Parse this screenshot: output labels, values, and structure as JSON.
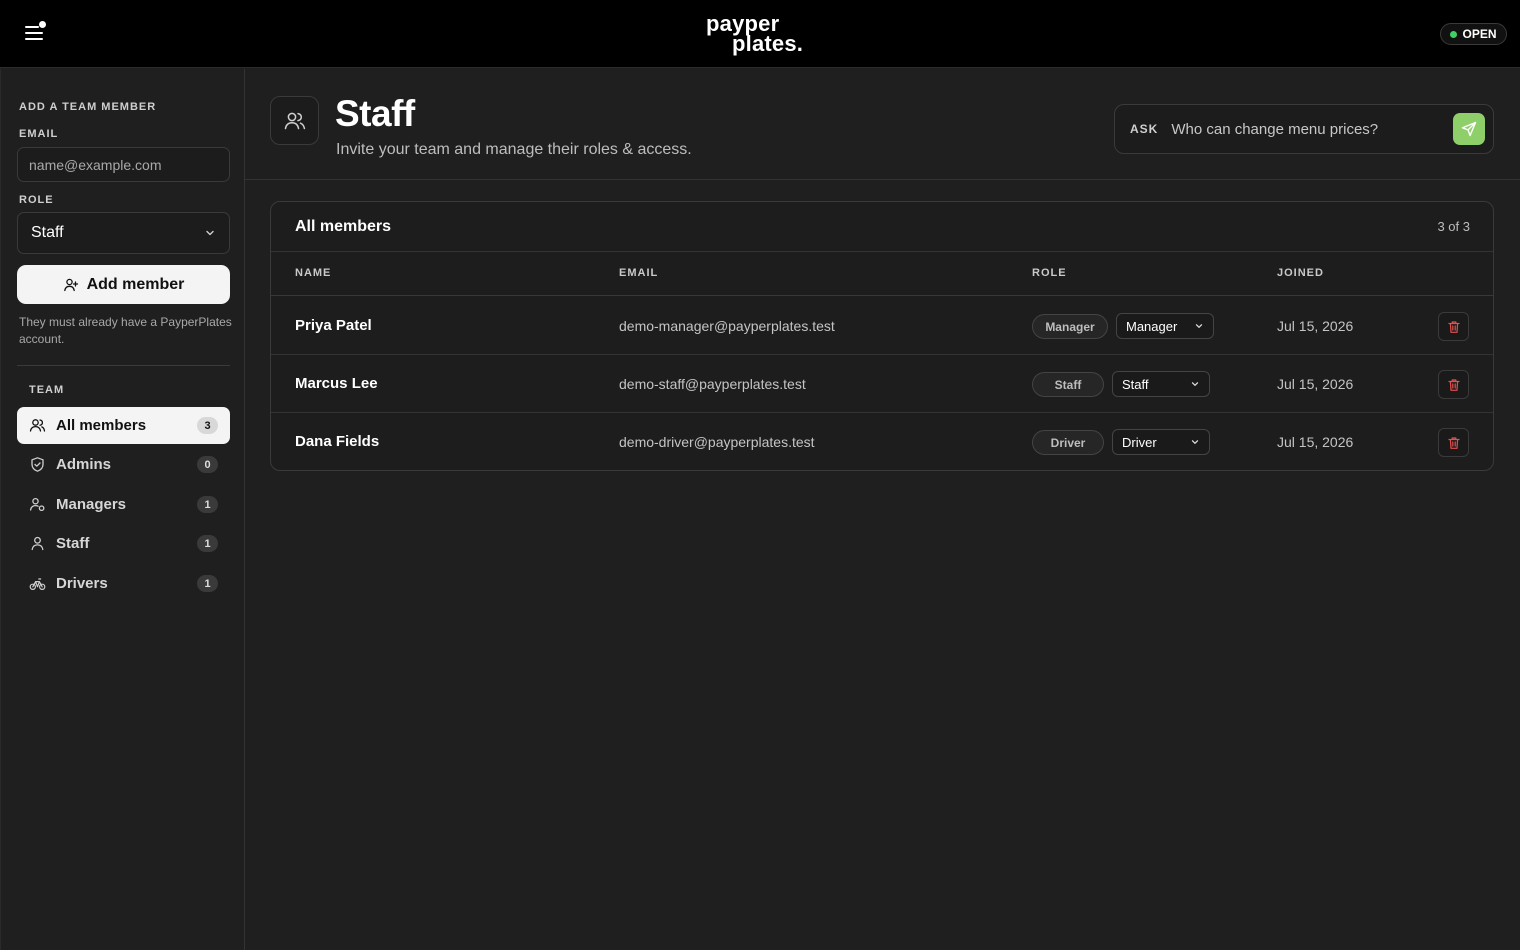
{
  "topbar": {
    "logo_line1": "payper",
    "logo_line2": "plates.",
    "status_label": "OPEN",
    "status_color": "#3fcf63"
  },
  "sidebar": {
    "add_heading": "ADD A TEAM MEMBER",
    "email_label": "EMAIL",
    "email_placeholder": "name@example.com",
    "email_value": "",
    "role_label": "ROLE",
    "role_value": "Staff",
    "add_button_label": "Add member",
    "hint": "They must already have a PayperPlates account.",
    "team_heading": "TEAM",
    "items": [
      {
        "label": "All members",
        "count": "3",
        "icon": "users-icon",
        "active": true
      },
      {
        "label": "Admins",
        "count": "0",
        "icon": "shield-icon",
        "active": false
      },
      {
        "label": "Managers",
        "count": "1",
        "icon": "user-cog-icon",
        "active": false
      },
      {
        "label": "Staff",
        "count": "1",
        "icon": "user-icon",
        "active": false
      },
      {
        "label": "Drivers",
        "count": "1",
        "icon": "bike-icon",
        "active": false
      }
    ]
  },
  "header": {
    "title": "Staff",
    "subtitle": "Invite your team and manage their roles & access.",
    "ask_label": "ASK",
    "ask_placeholder": "Who can change menu prices?",
    "send_color": "#8fcf6a"
  },
  "members": {
    "title": "All members",
    "count_text": "3 of 3",
    "columns": [
      "NAME",
      "EMAIL",
      "ROLE",
      "JOINED"
    ],
    "rows": [
      {
        "name": "Priya Patel",
        "email": "demo-manager@payperplates.test",
        "role_badge": "Manager",
        "role_select": "Manager",
        "joined": "Jul 15, 2026"
      },
      {
        "name": "Marcus Lee",
        "email": "demo-staff@payperplates.test",
        "role_badge": "Staff",
        "role_select": "Staff",
        "joined": "Jul 15, 2026"
      },
      {
        "name": "Dana Fields",
        "email": "demo-driver@payperplates.test",
        "role_badge": "Driver",
        "role_select": "Driver",
        "joined": "Jul 15, 2026"
      }
    ],
    "delete_color": "#e05252"
  }
}
